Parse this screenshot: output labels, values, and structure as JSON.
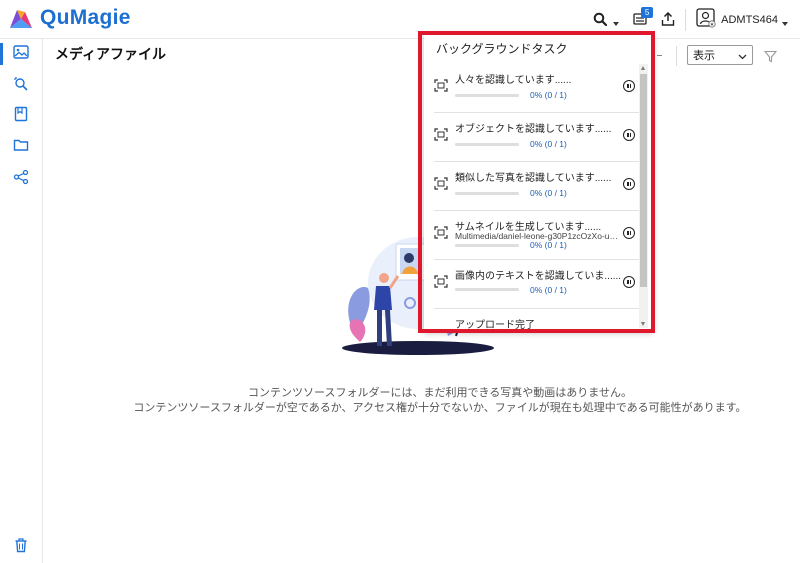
{
  "app": {
    "name": "QuMagie",
    "brand_color": "#1c6fd1",
    "accent_color": "#1e74d8"
  },
  "header": {
    "search_icon": "search-icon",
    "task_badge": "5",
    "upload_icon": "upload-icon",
    "user_name": "ADMTS464"
  },
  "sidebar": {
    "items": [
      {
        "icon": "photo-album-icon",
        "active": true
      },
      {
        "icon": "smart-search-icon",
        "active": false
      },
      {
        "icon": "bookmark-album-icon",
        "active": false
      },
      {
        "icon": "folder-icon",
        "active": false
      },
      {
        "icon": "share-icon",
        "active": false
      }
    ],
    "trash_icon": "trash-icon"
  },
  "main": {
    "title": "メディアファイル",
    "view_select": {
      "selected": "表示"
    },
    "empty_line1": "コンテンツソースフォルダーには、まだ利用できる写真や動画はありません。",
    "empty_line2": "コンテンツソースフォルダーが空であるか、アクセス権が十分でないか、ファイルが現在も処理中である可能性があります。"
  },
  "task_panel": {
    "title": "バックグラウンドタスク",
    "highlight_color": "#e0182d",
    "tasks": [
      {
        "name": "人々を認識しています......",
        "file": "",
        "progress": "0% (0 / 1)",
        "fraction": 0
      },
      {
        "name": "オブジェクトを認識しています......",
        "file": "",
        "progress": "0% (0 / 1)",
        "fraction": 0
      },
      {
        "name": "類似した写真を認識しています......",
        "file": "",
        "progress": "0% (0 / 1)",
        "fraction": 0
      },
      {
        "name": "サムネイルを生成しています......",
        "file": "Multimedia/daniel-leone-g30P1zcOzXo-un...",
        "progress": "0% (0 / 1)",
        "fraction": 0
      },
      {
        "name": "画像内のテキストを認識していま......",
        "file": "",
        "progress": "0% (0 / 1)",
        "fraction": 0
      }
    ],
    "upload_complete": "アップロード完了"
  }
}
